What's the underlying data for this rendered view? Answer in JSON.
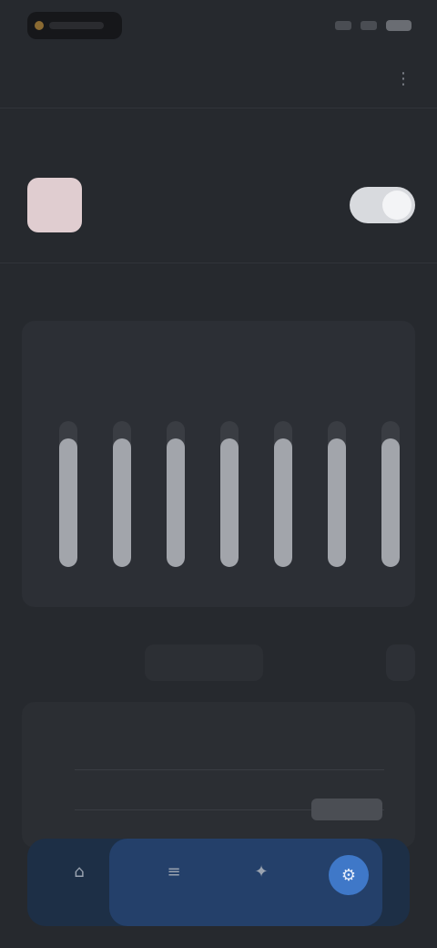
{
  "header": {
    "title": "",
    "link": ""
  },
  "sections": {
    "status": "",
    "equalizer": ""
  },
  "status": {
    "label": "",
    "enabled": true
  },
  "equalizer": {
    "title": "",
    "bands": [
      {
        "label": "",
        "level": 0.88
      },
      {
        "label": "",
        "level": 0.88
      },
      {
        "label": "",
        "level": 0.88
      },
      {
        "label": "",
        "level": 0.88
      },
      {
        "label": "",
        "level": 0.88
      },
      {
        "label": "",
        "level": 0.88
      },
      {
        "label": "",
        "level": 0.88
      }
    ]
  },
  "row2": {
    "left": "",
    "right": ""
  },
  "dsp": {
    "title": "",
    "chip": ""
  },
  "nav": {
    "items": [
      {
        "label": "",
        "icon": "home-icon"
      },
      {
        "label": "",
        "icon": "equalizer-icon"
      },
      {
        "label": "",
        "icon": "effects-icon"
      },
      {
        "label": "",
        "icon": "settings-icon"
      }
    ],
    "active_index": 3
  },
  "colors": {
    "accent": "#3f78c8",
    "section_label": "#4b6fa8",
    "background": "#26292e"
  }
}
